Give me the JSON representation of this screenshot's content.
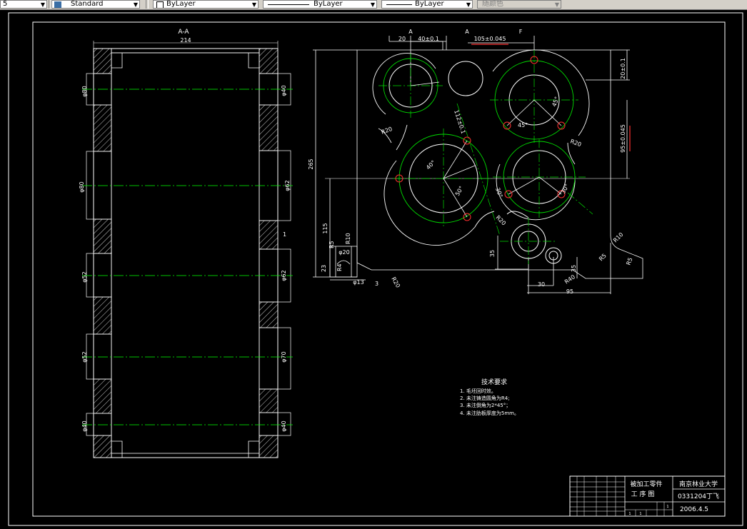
{
  "toolbar": {
    "first_field": "5",
    "text_style": "Standard",
    "layer": "ByLayer",
    "linetype": "ByLayer",
    "lineweight": "ByLayer",
    "plot_style": "随颜色"
  },
  "drawing": {
    "section_label": "A-A",
    "section_width": "214",
    "left_dims": [
      "φ80",
      "φ80",
      "φ52",
      "φ52",
      "φ40"
    ],
    "right_dims": [
      "φ40",
      "φ62",
      "φ62",
      "φ70",
      "φ40"
    ],
    "right_small": "1",
    "top_dims": [
      "20",
      "40±0.1",
      "105±0.045"
    ],
    "top_letters": [
      "A",
      "A",
      "F"
    ],
    "right_vert_dims": [
      "20±0.1",
      "95±0.045"
    ],
    "left_vert_dims": [
      "265",
      "115",
      "23",
      "35"
    ],
    "radius_labels": [
      "R20",
      "R20",
      "R20",
      "R10",
      "R5",
      "R20",
      "R10",
      "R5",
      "R40"
    ],
    "angle_labels": [
      "45°",
      "45°",
      "40°",
      "50°",
      "30°",
      "30°"
    ],
    "diag_dim": "112±0.1",
    "bottom_dims": [
      "30",
      "95",
      "35",
      "3",
      "φ13",
      "φ20"
    ],
    "bottom_detail": [
      "R5",
      "φ20",
      "R10",
      "R4",
      "R8"
    ]
  },
  "tech_req": {
    "title": "技术要求",
    "items": [
      "1.  毛坯回时效。",
      "2. 未注铸造圆角为R4;",
      "3. 未注倒角为2*45°；",
      "4. 未注肋板厚度为5mm。"
    ]
  },
  "title_block": {
    "part_name": "被加工零件",
    "drawing_type": "工 序 图",
    "school": "南京林业大学",
    "student": "0331204丁飞",
    "date": "2006.4.5",
    "small_cells": [
      "1",
      "1",
      "1"
    ]
  }
}
